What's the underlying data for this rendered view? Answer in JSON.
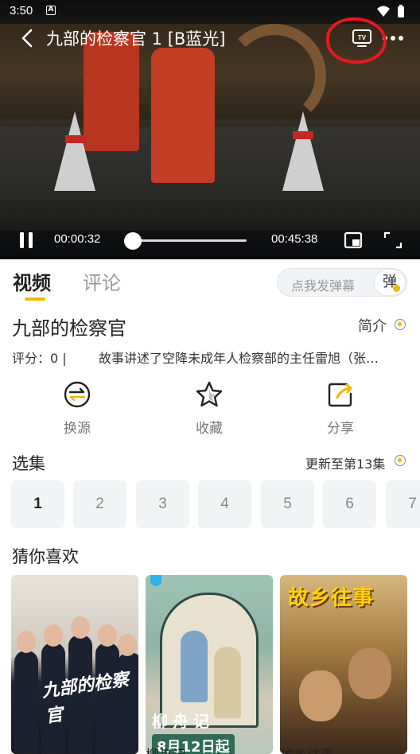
{
  "status_bar": {
    "time": "3:50",
    "notif_letter": "A"
  },
  "player": {
    "title": "九部的检察官 1 [B蓝光]",
    "current_time": "00:00:32",
    "total_time": "00:45:38",
    "progress": 0.012
  },
  "tabs": [
    {
      "label": "视频",
      "active": true
    },
    {
      "label": "评论",
      "active": false
    }
  ],
  "danmu": {
    "placeholder": "点我发弹幕",
    "toggle_label": "弹"
  },
  "show": {
    "title": "九部的检察官",
    "intro_label": "简介",
    "rating": "评分：0 |",
    "description": "故事讲述了空降未成年人检察部的主任雷旭（张…"
  },
  "actions": [
    {
      "label": "换源",
      "icon": "switch-source-icon"
    },
    {
      "label": "收藏",
      "icon": "star-icon"
    },
    {
      "label": "分享",
      "icon": "share-icon"
    }
  ],
  "episodes_section": {
    "title": "选集",
    "update_text": "更新至第13集",
    "episodes": [
      "1",
      "2",
      "3",
      "4",
      "5",
      "6",
      "7"
    ],
    "current": "1"
  },
  "recommend": {
    "title": "猜你喜欢",
    "posters": [
      {
        "art_title": "九部的检察官"
      },
      {
        "art_title": "柳舟记",
        "art_date": "8月12日起"
      },
      {
        "art_title": "故乡往事"
      }
    ],
    "captions": [
      "九部的检察官",
      "柳舟记",
      "故乡往事"
    ]
  },
  "colors": {
    "accent": "#f7b500",
    "annotation_red": "#e5191c"
  }
}
